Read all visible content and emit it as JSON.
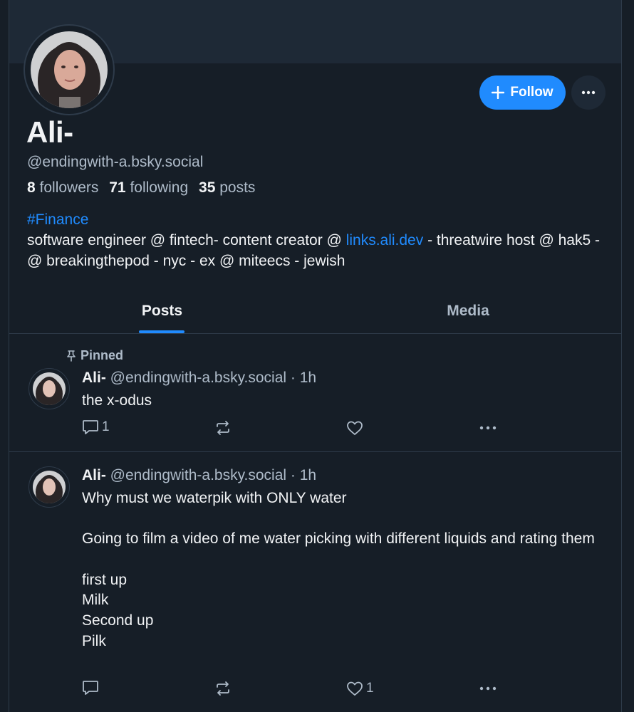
{
  "profile": {
    "display_name": "Ali-",
    "handle": "@endingwith-a.bsky.social",
    "followers_count": "8",
    "followers_label": "followers",
    "following_count": "71",
    "following_label": "following",
    "posts_count": "35",
    "posts_label": "posts",
    "hashtag": "#Finance",
    "bio_part1": "software engineer @ fintech- content creator @ ",
    "bio_link": "links.ali.dev",
    "bio_part2": " - threatwire host @ hak5 - @ breakingthepod - nyc - ex @ miteecs - jewish"
  },
  "actions": {
    "follow_label": "Follow"
  },
  "tabs": [
    {
      "label": "Posts",
      "active": true
    },
    {
      "label": "Media",
      "active": false
    }
  ],
  "posts": [
    {
      "pinned_label": "Pinned",
      "author": "Ali-",
      "handle": "@endingwith-a.bsky.social",
      "time": "1h",
      "text": "the x-odus",
      "reply_count": "1",
      "repost_count": "",
      "like_count": ""
    },
    {
      "author": "Ali-",
      "handle": "@endingwith-a.bsky.social",
      "time": "1h",
      "lines": [
        "Why must we waterpik with ONLY water",
        "",
        "Going to film a video of me water picking with different liquids and rating them",
        "",
        "first up",
        "Milk",
        "Second up",
        "Pilk"
      ],
      "reply_count": "",
      "repost_count": "",
      "like_count": "1"
    }
  ],
  "colors": {
    "background": "#161e27",
    "banner": "#1e2936",
    "accent": "#208bfe",
    "text": "#f1f3f5",
    "muted": "#aebbc9",
    "border": "#2e3b4a"
  }
}
